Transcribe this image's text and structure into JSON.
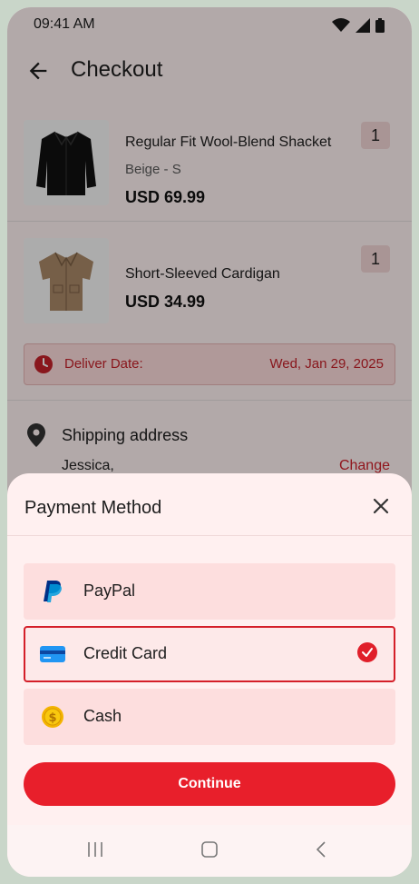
{
  "status": {
    "time": "09:41 AM"
  },
  "header": {
    "title": "Checkout"
  },
  "items": [
    {
      "name": "Regular Fit Wool-Blend Shacket",
      "variant": "Beige - S",
      "price": "USD 69.99",
      "qty": "1"
    },
    {
      "name": "Short-Sleeved Cardigan",
      "price": "USD 34.99",
      "qty": "1"
    }
  ],
  "delivery": {
    "label": "Deliver Date:",
    "date": "Wed, Jan 29, 2025"
  },
  "shipping": {
    "title": "Shipping address",
    "name": "Jessica,",
    "change": "Change"
  },
  "payment_sheet": {
    "title": "Payment Method",
    "options": [
      {
        "label": "PayPal",
        "icon": "paypal-icon"
      },
      {
        "label": "Credit Card",
        "icon": "credit-card-icon",
        "selected": true
      },
      {
        "label": "Cash",
        "icon": "coin-icon"
      }
    ],
    "continue_label": "Continue"
  },
  "colors": {
    "accent": "#e81f2b",
    "accent_dark": "#c5222a",
    "sheet_bg": "#fff0f0",
    "option_bg": "#fddede"
  }
}
